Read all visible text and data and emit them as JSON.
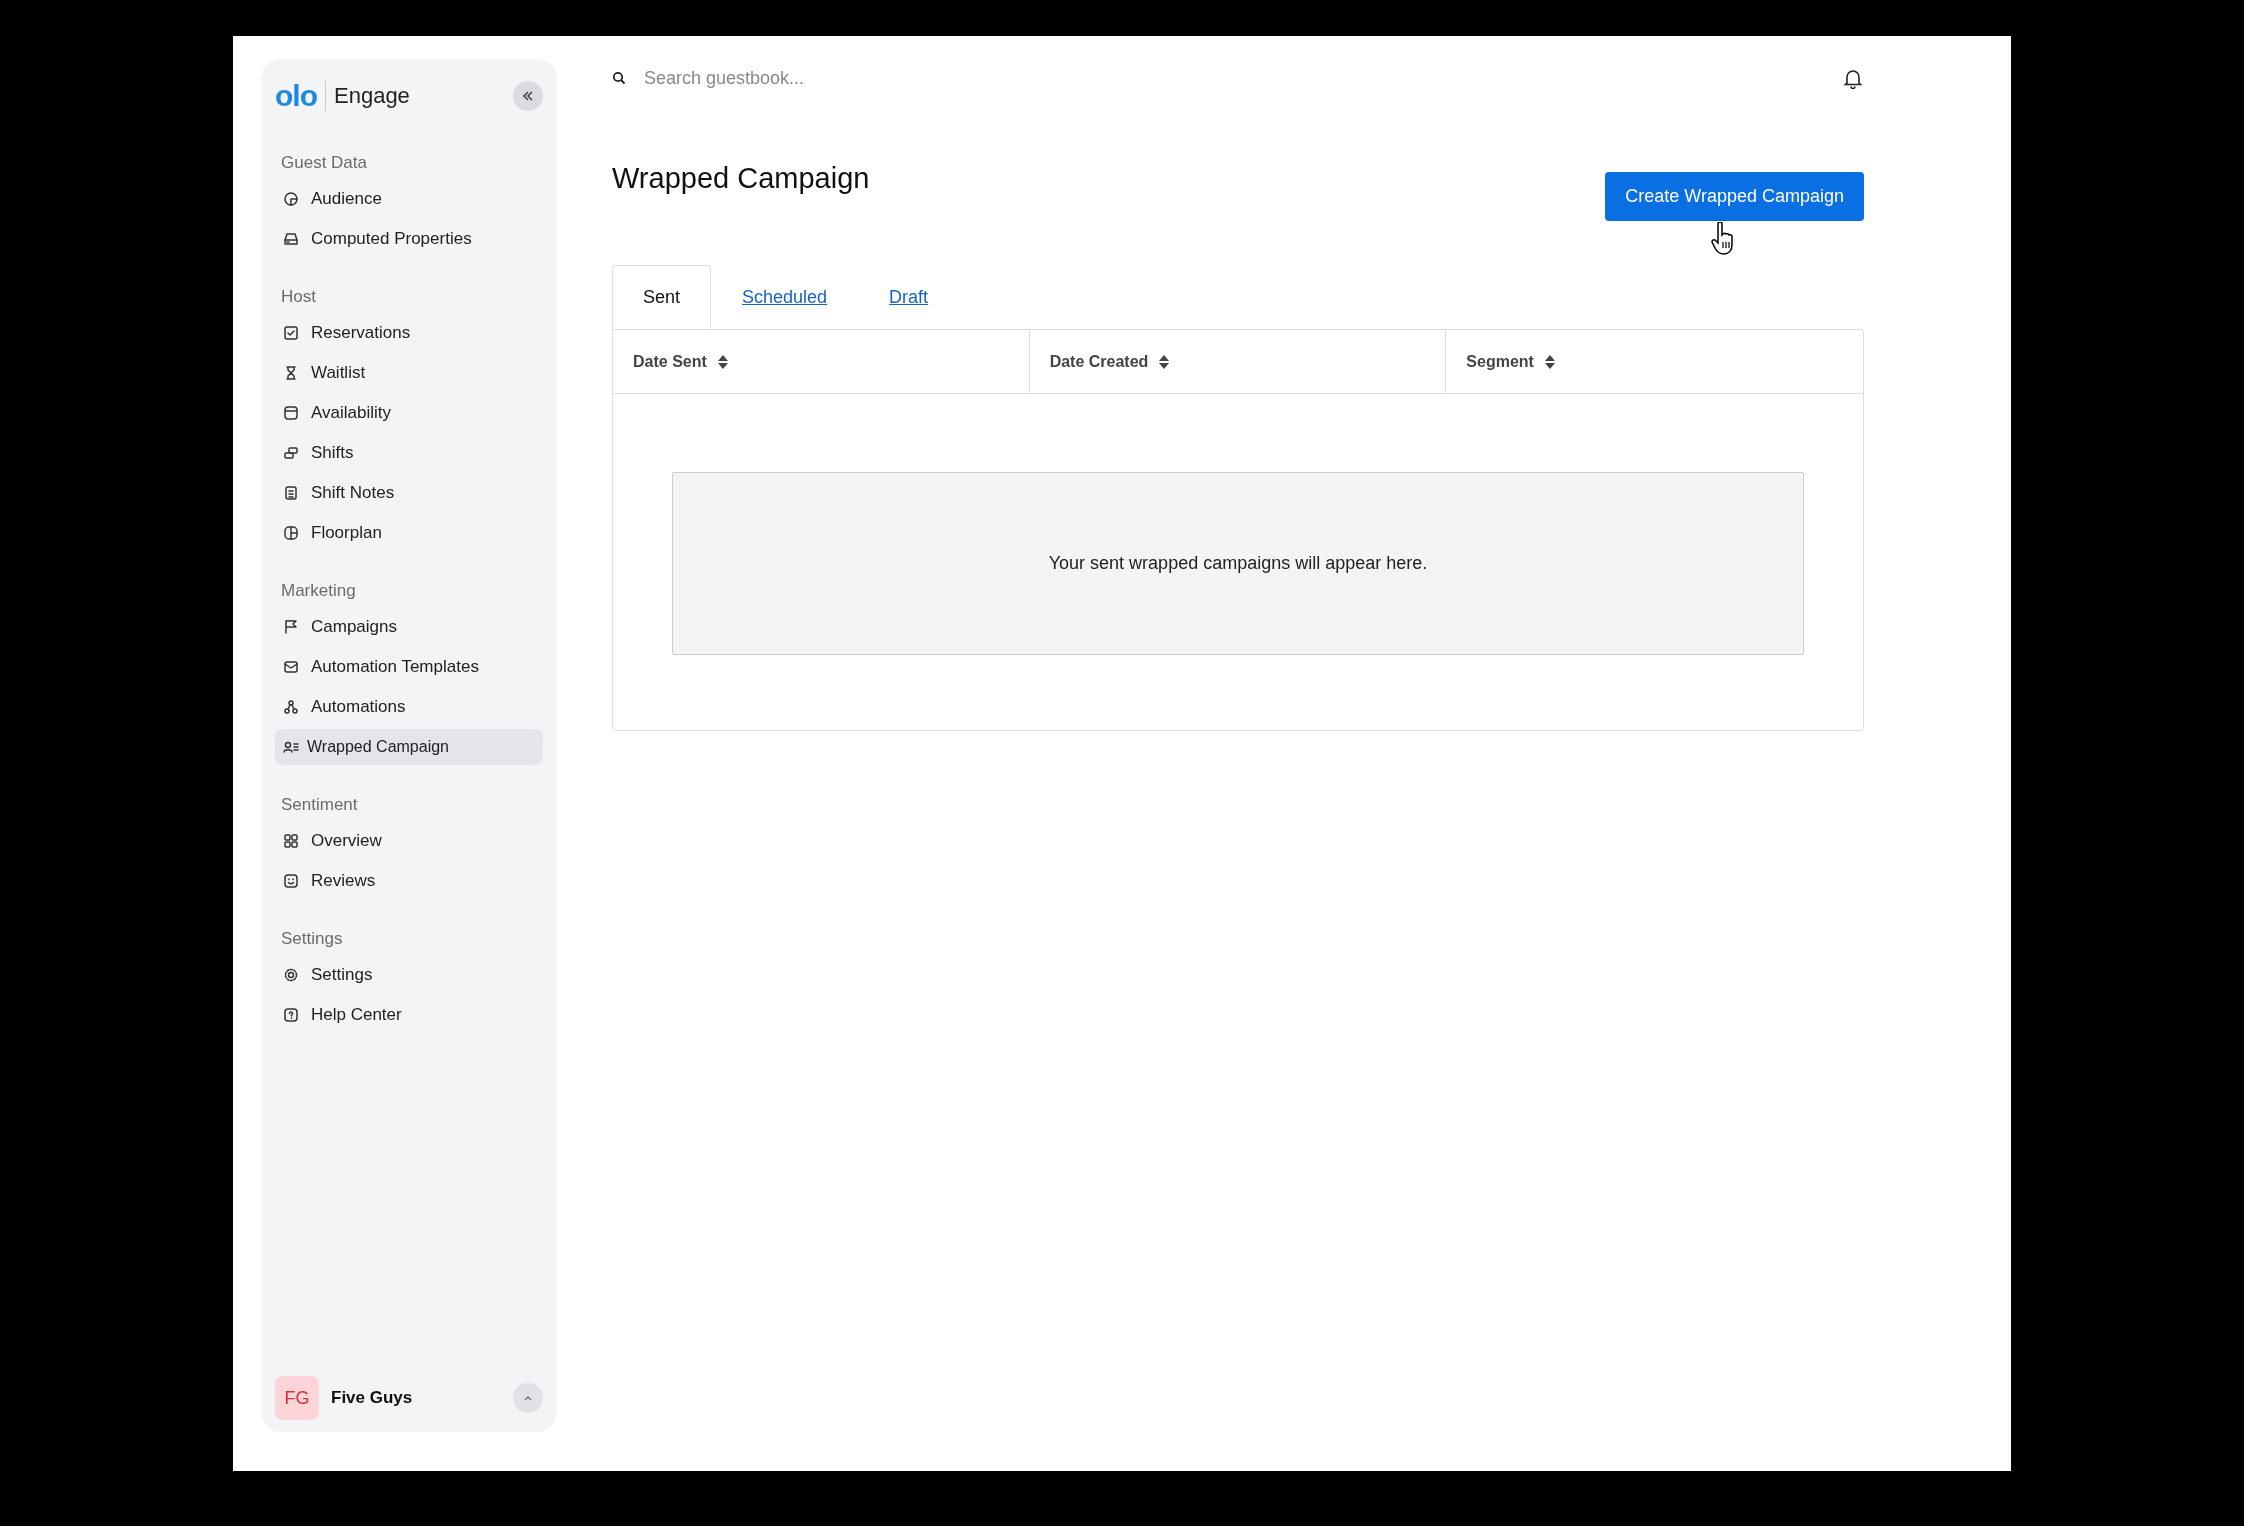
{
  "sidebar": {
    "brand": {
      "logo": "olo",
      "name": "Engage"
    },
    "sections": [
      {
        "title": "Guest Data",
        "items": [
          {
            "label": "Audience",
            "selected": false
          },
          {
            "label": "Computed Properties",
            "selected": false
          }
        ]
      },
      {
        "title": "Host",
        "items": [
          {
            "label": "Reservations",
            "selected": false
          },
          {
            "label": "Waitlist",
            "selected": false
          },
          {
            "label": "Availability",
            "selected": false
          },
          {
            "label": "Shifts",
            "selected": false
          },
          {
            "label": "Shift Notes",
            "selected": false
          },
          {
            "label": "Floorplan",
            "selected": false
          }
        ]
      },
      {
        "title": "Marketing",
        "items": [
          {
            "label": "Campaigns",
            "selected": false
          },
          {
            "label": "Automation Templates",
            "selected": false
          },
          {
            "label": "Automations",
            "selected": false
          },
          {
            "label": "Wrapped Campaign",
            "selected": true
          }
        ]
      },
      {
        "title": "Sentiment",
        "items": [
          {
            "label": "Overview",
            "selected": false
          },
          {
            "label": "Reviews",
            "selected": false
          }
        ]
      },
      {
        "title": "Settings",
        "items": [
          {
            "label": "Settings",
            "selected": false
          },
          {
            "label": "Help Center",
            "selected": false
          }
        ]
      }
    ],
    "account": {
      "initials": "FG",
      "name": "Five Guys"
    }
  },
  "search": {
    "placeholder": "Search guestbook..."
  },
  "page": {
    "title": "Wrapped Campaign",
    "create_button": "Create Wrapped Campaign"
  },
  "tabs": [
    {
      "label": "Sent",
      "selected": true
    },
    {
      "label": "Scheduled",
      "selected": false
    },
    {
      "label": "Draft",
      "selected": false
    }
  ],
  "table": {
    "columns": [
      "Date Sent",
      "Date Created",
      "Segment"
    ],
    "empty_message": "Your sent wrapped campaigns will appear here."
  }
}
